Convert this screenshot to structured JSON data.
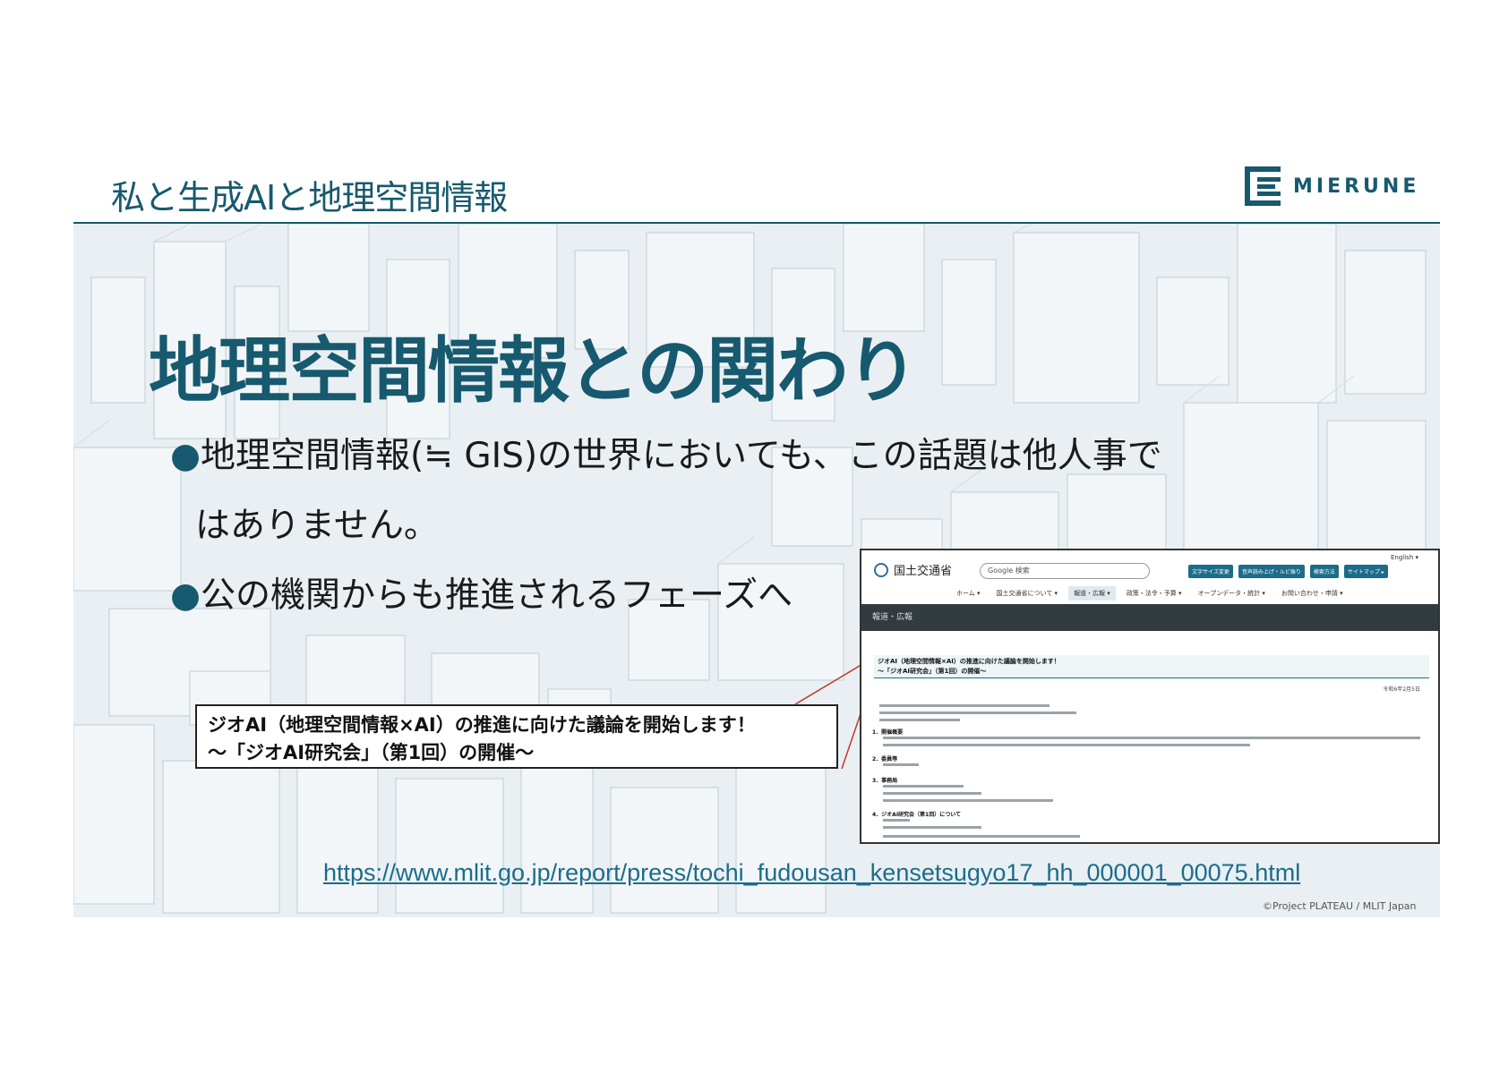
{
  "header": {
    "title": "私と生成AIと地理空間情報",
    "logo_text": "MIERUNE"
  },
  "slide": {
    "title": "地理空間情報との関わり",
    "bullets": [
      {
        "marker": "●",
        "lines": [
          "地理空間情報(≒ GIS)の世界においても、この話題は他人事で",
          "はありません。"
        ]
      },
      {
        "marker": "●",
        "lines": [
          "公の機関からも推進されるフェーズへ"
        ]
      }
    ],
    "callout": {
      "line1": "ジオAI（地理空間情報×AI）の推進に向けた議論を開始します！",
      "line2": "～「ジオAI研究会」（第1回）の開催～"
    },
    "url": "https://www.mlit.go.jp/report/press/tochi_fudousan_kensetsugyo17_hh_000001_00075.html",
    "credit": "©Project PLATEAU / MLIT Japan"
  },
  "screenshot": {
    "brand": "国土交通省",
    "language": "English ▾",
    "search_placeholder": "Google 検索",
    "top_buttons": [
      "文字サイズ変更",
      "音声読み上げ・ルビ振り",
      "検索方法",
      "サイトマップ ▸"
    ],
    "nav": [
      "ホーム ▾",
      "国土交通省について ▾",
      "報道・広報 ▾",
      "政策・法令・予算 ▾",
      "オープンデータ・統計 ▾",
      "お問い合わせ・申請 ▾"
    ],
    "section_bar": "報道・広報",
    "heading_line1": "ジオAI（地理空間情報×AI）の推進に向けた議論を開始します！",
    "heading_line2": "～「ジオAI研究会」（第1回）の開催～",
    "date": "令和6年2月5日",
    "sections": [
      "1．開催概要",
      "2．委員等",
      "3．事務局",
      "4．ジオAI研究会（第1回）について"
    ]
  },
  "colors": {
    "brand": "#17596e",
    "background_tint": "#e9eff2",
    "screenshot_bar": "#323b40",
    "button": "#1b6c8a"
  }
}
